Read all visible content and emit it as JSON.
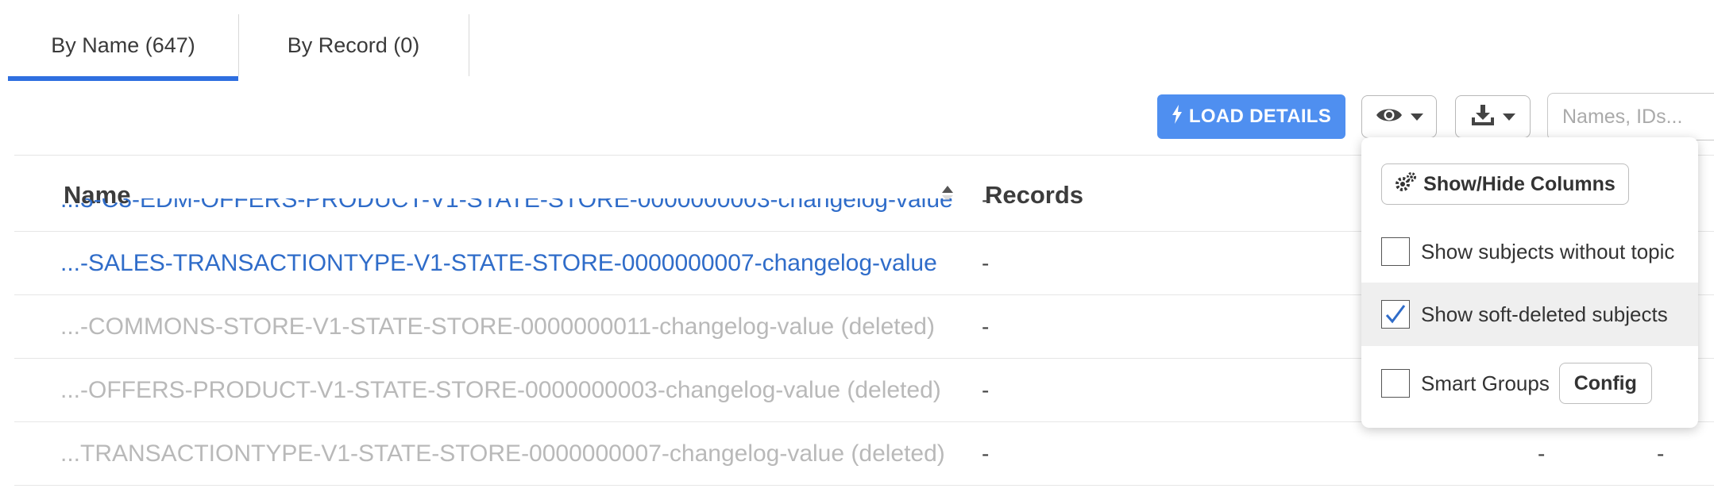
{
  "tabs": [
    {
      "label": "By Name (647)",
      "active": true
    },
    {
      "label": "By Record (0)",
      "active": false
    }
  ],
  "toolbar": {
    "load_details_label": "LOAD DETAILS",
    "view_icon": "eye-icon",
    "download_icon": "download-icon",
    "search_placeholder": "Names, IDs..."
  },
  "table": {
    "columns": {
      "name": "Name",
      "records": "Records"
    },
    "sort": "ascending",
    "rows": [
      {
        "name": "...3-C3-EDM-OFFERS-PRODUCT-V1-STATE-STORE-0000000003-changelog-value",
        "records": "-",
        "deleted": false
      },
      {
        "name": "...-SALES-TRANSACTIONTYPE-V1-STATE-STORE-0000000007-changelog-value",
        "records": "-",
        "deleted": false
      },
      {
        "name": "...-COMMONS-STORE-V1-STATE-STORE-0000000011-changelog-value (deleted)",
        "records": "-",
        "deleted": true
      },
      {
        "name": "...-OFFERS-PRODUCT-V1-STATE-STORE-0000000003-changelog-value (deleted)",
        "records": "-",
        "deleted": true
      },
      {
        "name": "...TRANSACTIONTYPE-V1-STATE-STORE-0000000007-changelog-value (deleted)",
        "records": "-",
        "deleted": true,
        "extra": [
          "-",
          "-"
        ]
      }
    ]
  },
  "popover": {
    "show_hide_columns_label": "Show/Hide Columns",
    "options": [
      {
        "label": "Show subjects without topic",
        "checked": false
      },
      {
        "label": "Show soft-deleted subjects",
        "checked": true
      },
      {
        "label": "Smart Groups",
        "checked": false
      }
    ],
    "config_label": "Config"
  },
  "colors": {
    "accent": "#4f8ff0",
    "link": "#2f6cc9",
    "deleted_text": "#b9b9b9",
    "tab_underline": "#2f6fe0"
  }
}
